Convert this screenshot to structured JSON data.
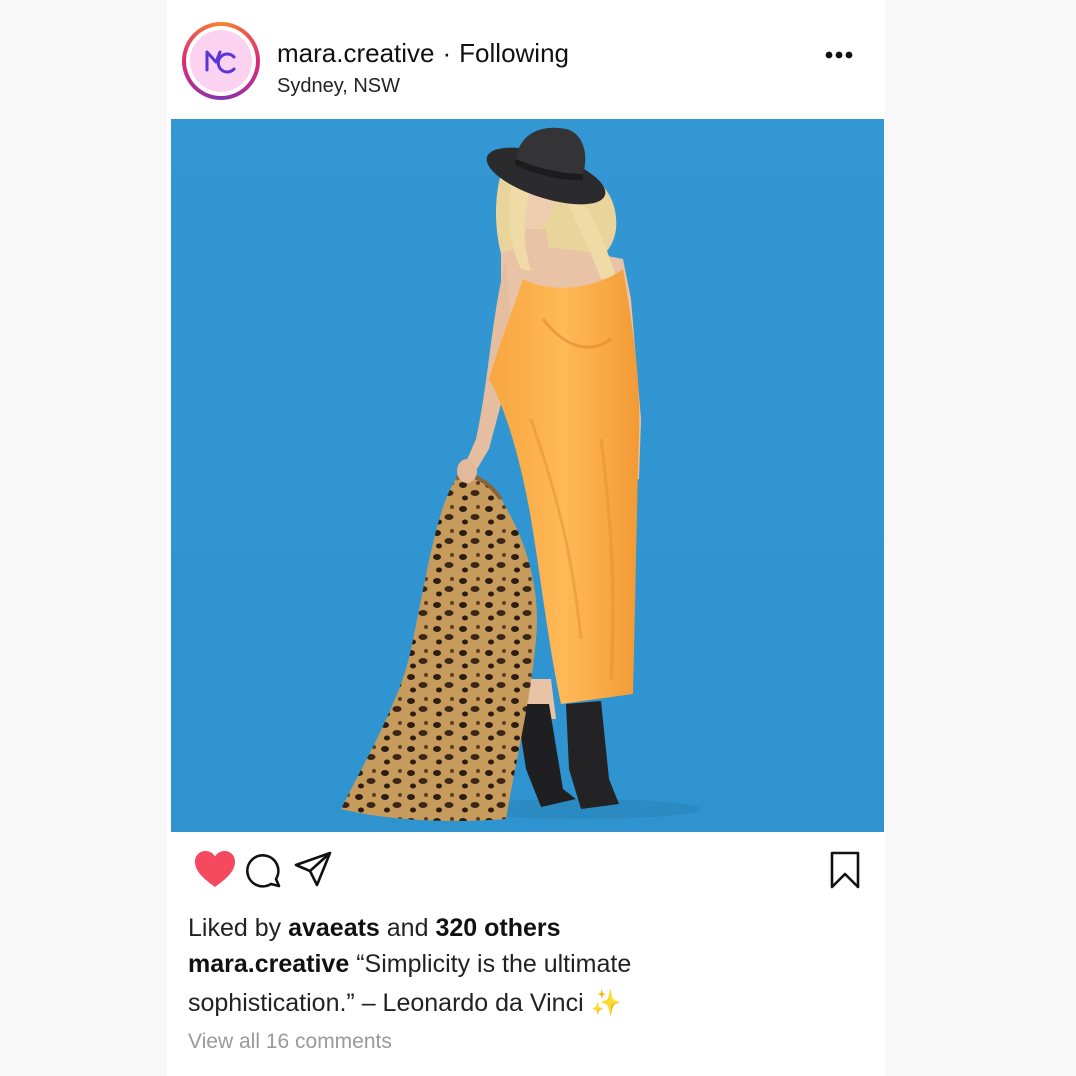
{
  "post": {
    "username": "mara.creative",
    "separator": "·",
    "follow_status": "Following",
    "location": "Sydney, NSW",
    "avatar_initials": "MC"
  },
  "engagement": {
    "liked_by_prefix": "Liked by",
    "liked_by_user": "avaeats",
    "liked_by_middle": "and",
    "liked_by_others": "320 others"
  },
  "caption": {
    "username": "mara.creative",
    "text": "“Simplicity is the ultimate sophistication.” – Leonardo da Vinci",
    "emoji": "✨"
  },
  "comments": {
    "link_text": "View all 16 comments"
  },
  "icons": {
    "like": "heart-icon",
    "comment": "comment-icon",
    "share": "share-icon",
    "save": "bookmark-icon",
    "more": "more-icon"
  },
  "colors": {
    "like_active": "#f5495f",
    "photo_background": "#3296d2",
    "avatar_bg": "#fbd3f0",
    "avatar_mark": "#5a35d8"
  }
}
